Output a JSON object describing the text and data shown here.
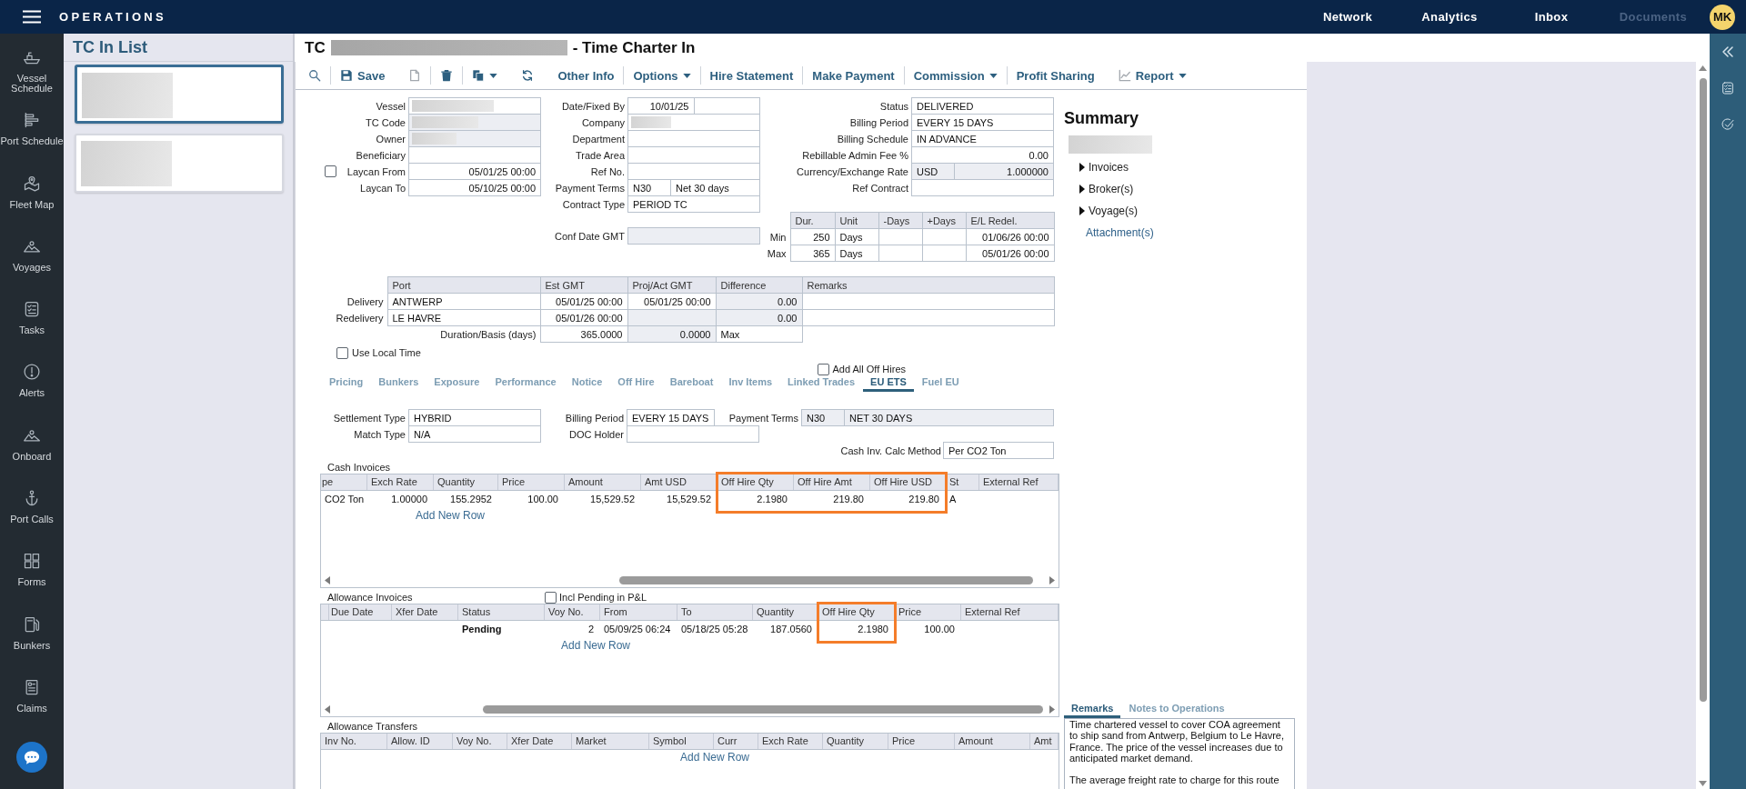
{
  "header": {
    "menu_title": "OPERATIONS",
    "nav": [
      {
        "label": "Network",
        "disabled": false
      },
      {
        "label": "Analytics",
        "disabled": false
      },
      {
        "label": "Inbox",
        "disabled": false
      },
      {
        "label": "Documents",
        "disabled": true
      }
    ],
    "avatar": "MK"
  },
  "sidebar": {
    "items": [
      {
        "label": "Vessel Schedule"
      },
      {
        "label": "Port Schedule"
      },
      {
        "label": "Fleet Map"
      },
      {
        "label": "Voyages"
      },
      {
        "label": "Tasks"
      },
      {
        "label": "Alerts"
      },
      {
        "label": "Onboard"
      },
      {
        "label": "Port Calls"
      },
      {
        "label": "Forms"
      },
      {
        "label": "Bunkers"
      },
      {
        "label": "Claims"
      }
    ]
  },
  "list_panel": {
    "title": "TC In List",
    "cards": [
      {
        "selected": true
      },
      {
        "selected": false
      }
    ]
  },
  "record": {
    "title_prefix": "TC",
    "title_suffix": "- Time Charter In"
  },
  "toolbar": {
    "groups": [
      [
        {
          "kind": "icon"
        }
      ],
      [
        {
          "kind": "icon_text",
          "label": "Save"
        },
        {
          "kind": "icon"
        }
      ],
      [
        {
          "kind": "icon"
        }
      ],
      [
        {
          "kind": "icon_menu"
        },
        {
          "kind": "icon"
        },
        {
          "kind": "text",
          "label": "Other Info"
        }
      ],
      [
        {
          "kind": "menu",
          "label": "Options"
        }
      ],
      [
        {
          "kind": "text",
          "label": "Hire Statement"
        }
      ],
      [
        {
          "kind": "text",
          "label": "Make Payment"
        }
      ],
      [
        {
          "kind": "menu",
          "label": "Commission"
        }
      ],
      [
        {
          "kind": "text",
          "label": "Profit Sharing"
        },
        {
          "kind": "icon_text_menu",
          "label": "Report"
        }
      ]
    ]
  },
  "details": {
    "left": [
      {
        "label": "Vessel",
        "cells": [
          {
            "kind": "redacted",
            "readonly": false
          }
        ]
      },
      {
        "label": "TC Code",
        "cells": [
          {
            "kind": "redacted",
            "readonly": true
          }
        ]
      },
      {
        "label": "Owner",
        "cells": [
          {
            "kind": "redacted",
            "readonly": true
          }
        ]
      },
      {
        "label": "Beneficiary",
        "cells": [
          {
            "readonly": false
          }
        ]
      },
      {
        "label": "Laycan From",
        "checkbox": {
          "checked": false
        },
        "cells": [
          {
            "kind": "number",
            "value": "05/01/25 00:00",
            "readonly": false
          }
        ]
      },
      {
        "label": "Laycan To",
        "cells": [
          {
            "kind": "number",
            "value": "05/10/25 00:00",
            "readonly": false
          }
        ]
      }
    ],
    "middle": [
      {
        "label": "Date/Fixed By",
        "cells": [
          {
            "kind": "number",
            "value": "10/01/25",
            "readonly": false
          },
          {
            "readonly": false
          }
        ]
      },
      {
        "label": "Company",
        "cells": [
          {
            "kind": "redacted",
            "readonly": false
          }
        ]
      },
      {
        "label": "Department",
        "cells": [
          {
            "readonly": false
          }
        ]
      },
      {
        "label": "Trade Area",
        "cells": [
          {
            "readonly": false
          }
        ]
      },
      {
        "label": "Ref No.",
        "cells": [
          {
            "readonly": false
          }
        ]
      },
      {
        "label": "Payment Terms",
        "cells": [
          {
            "kind": "code",
            "value": "N30",
            "readonly": false
          },
          {
            "kind": "text",
            "value": "Net 30 days",
            "readonly": false
          }
        ]
      },
      {
        "label": "Contract Type",
        "cells": [
          {
            "kind": "text",
            "value": "PERIOD TC",
            "readonly": false
          }
        ]
      }
    ],
    "right": [
      {
        "label": "Status",
        "cells": [
          {
            "kind": "text",
            "value": "DELIVERED",
            "readonly": false
          }
        ]
      },
      {
        "label": "Billing Period",
        "cells": [
          {
            "kind": "text",
            "value": "EVERY 15 DAYS",
            "readonly": false
          }
        ]
      },
      {
        "label": "Billing Schedule",
        "cells": [
          {
            "kind": "text",
            "value": "IN ADVANCE",
            "readonly": false
          }
        ]
      },
      {
        "label": "Rebillable Admin Fee %",
        "cells": [
          {
            "kind": "number",
            "value": "0.00",
            "readonly": false
          }
        ]
      },
      {
        "label": "Currency/Exchange Rate",
        "cells": [
          {
            "kind": "code",
            "value": "USD",
            "readonly": true
          },
          {
            "kind": "number",
            "value": "1.000000",
            "readonly": true
          }
        ]
      },
      {
        "label": "Ref Contract",
        "cells": [
          {
            "readonly": false
          }
        ]
      }
    ],
    "conf_date": {
      "label": "Conf Date GMT",
      "cells": [
        {
          "readonly": true
        }
      ]
    },
    "duration": {
      "columns": [
        {
          "label": "Dur.",
          "kind": "number"
        },
        {
          "label": "Unit",
          "kind": "text"
        },
        {
          "label": "-Days"
        },
        {
          "label": "+Days"
        },
        {
          "label": "E/L Redel.",
          "kind": "number"
        }
      ],
      "rows": [
        {
          "label": "Min",
          "cells": [
            "250",
            "Days",
            null,
            null,
            "01/06/26 00:00"
          ]
        },
        {
          "label": "Max",
          "cells": [
            "365",
            "Days",
            null,
            null,
            "05/01/26 00:00"
          ]
        }
      ]
    }
  },
  "ports": {
    "columns": [
      {
        "label": "Port",
        "kind": "text"
      },
      {
        "label": "Est GMT",
        "kind": "number"
      },
      {
        "label": "Proj/Act GMT",
        "kind": "number"
      },
      {
        "label": "Difference",
        "kind": "number"
      },
      {
        "label": "Remarks"
      }
    ],
    "rows": [
      {
        "label": "Delivery",
        "cells": [
          {
            "value": "ANTWERP",
            "readonly": false
          },
          {
            "value": "05/01/25 00:00",
            "readonly": false
          },
          {
            "value": "05/01/25 00:00",
            "readonly": false
          },
          {
            "value": "0.00",
            "readonly": true
          },
          {
            "readonly": false
          }
        ]
      },
      {
        "label": "Redelivery",
        "cells": [
          {
            "value": "LE HAVRE",
            "readonly": false
          },
          {
            "value": "05/01/26 00:00",
            "readonly": false
          },
          {
            "readonly": true
          },
          {
            "value": "0.00",
            "readonly": true
          },
          {
            "readonly": false
          }
        ]
      }
    ],
    "duration_row": {
      "label": "Duration/Basis (days)",
      "cells": [
        {
          "kind": "number",
          "value": "365.0000",
          "readonly": false
        },
        {
          "kind": "number",
          "value": "0.0000",
          "readonly": true
        },
        {
          "kind": "text",
          "value": "Max",
          "readonly": false
        }
      ]
    }
  },
  "use_local_time": {
    "label": "Use Local Time",
    "checked": false
  },
  "add_all_off_hires": {
    "label": "Add All Off Hires",
    "checked": false
  },
  "tabs": [
    {
      "label": "Pricing",
      "selected": false
    },
    {
      "label": "Bunkers",
      "selected": false
    },
    {
      "label": "Exposure",
      "selected": false
    },
    {
      "label": "Performance",
      "selected": false
    },
    {
      "label": "Notice",
      "selected": false
    },
    {
      "label": "Off Hire",
      "selected": false
    },
    {
      "label": "Bareboat",
      "selected": false
    },
    {
      "label": "Inv Items",
      "selected": false
    },
    {
      "label": "Linked Trades",
      "selected": false
    },
    {
      "label": "EU ETS",
      "selected": true
    },
    {
      "label": "Fuel EU",
      "selected": false
    }
  ],
  "eu_ets": {
    "rows": [
      [
        {
          "label": "Settlement Type",
          "cells": [
            {
              "kind": "text",
              "value": "HYBRID",
              "readonly": false
            }
          ]
        },
        {
          "label": "Billing Period",
          "cells": [
            {
              "kind": "text",
              "value": "EVERY 15 DAYS",
              "readonly": false
            }
          ]
        },
        {
          "label": "Payment Terms",
          "cells": [
            {
              "kind": "code",
              "value": "N30",
              "readonly": true
            },
            {
              "kind": "text",
              "value": "NET 30 DAYS",
              "readonly": true
            }
          ]
        }
      ],
      [
        {
          "label": "Match Type",
          "cells": [
            {
              "kind": "text",
              "value": "N/A",
              "readonly": false
            }
          ]
        },
        {
          "label": "DOC Holder",
          "cells": [
            {
              "readonly": false
            }
          ]
        }
      ],
      [
        {
          "label": "Cash Inv. Calc Method",
          "cells": [
            {
              "kind": "text",
              "value": "Per CO2 Ton",
              "readonly": false
            }
          ]
        }
      ]
    ]
  },
  "cash_invoices": {
    "title": "Cash Invoices",
    "columns": [
      {
        "label": "pe",
        "kind": "text",
        "highlighted": false
      },
      {
        "label": "Exch Rate",
        "kind": "number",
        "highlighted": false
      },
      {
        "label": "Quantity",
        "kind": "number",
        "highlighted": false
      },
      {
        "label": "Price",
        "kind": "number",
        "highlighted": false
      },
      {
        "label": "Amount",
        "kind": "number",
        "highlighted": false
      },
      {
        "label": "Amt USD",
        "kind": "number",
        "highlighted": false
      },
      {
        "label": "Off Hire Qty",
        "kind": "number",
        "highlighted": true
      },
      {
        "label": "Off Hire Amt",
        "kind": "number",
        "highlighted": true
      },
      {
        "label": "Off Hire USD",
        "kind": "number",
        "highlighted": true
      },
      {
        "label": "St",
        "kind": "text",
        "highlighted": false
      },
      {
        "label": "External Ref",
        "highlighted": false
      }
    ],
    "rows": [
      [
        "CO2 Ton",
        "1.00000",
        "155.2952",
        "100.00",
        "15,529.52",
        "15,529.52",
        "2.1980",
        "219.80",
        "219.80",
        "A",
        null
      ]
    ],
    "add_row": "Add New Row"
  },
  "allowance_invoices": {
    "title": "Allowance Invoices",
    "checkbox": {
      "label": "Incl Pending in P&L",
      "checked": false
    },
    "columns": [
      {
        "label": "Due Date",
        "highlighted": false
      },
      {
        "label": "Xfer Date",
        "highlighted": false
      },
      {
        "label": "Status",
        "kind": "status",
        "highlighted": false
      },
      {
        "label": "Voy No.",
        "kind": "number",
        "highlighted": false
      },
      {
        "label": "From",
        "kind": "text",
        "highlighted": false
      },
      {
        "label": "To",
        "kind": "text",
        "highlighted": false
      },
      {
        "label": "Quantity",
        "kind": "number",
        "highlighted": false
      },
      {
        "label": "Off Hire Qty",
        "kind": "number",
        "highlighted": true
      },
      {
        "label": "Price",
        "kind": "number",
        "highlighted": false
      },
      {
        "label": "External Ref",
        "highlighted": false
      }
    ],
    "rows": [
      [
        null,
        null,
        "Pending",
        "2",
        "05/09/25 06:24",
        "05/18/25 05:28",
        "187.0560",
        "2.1980",
        "100.00",
        null
      ]
    ],
    "add_row": "Add New Row"
  },
  "allowance_transfers": {
    "title": "Allowance Transfers",
    "columns": [
      {
        "label": "Inv No.",
        "highlighted": false
      },
      {
        "label": "Allow. ID",
        "highlighted": false
      },
      {
        "label": "Voy No.",
        "highlighted": false
      },
      {
        "label": "Xfer Date",
        "highlighted": false
      },
      {
        "label": "Market",
        "highlighted": false
      },
      {
        "label": "Symbol",
        "highlighted": false
      },
      {
        "label": "Curr",
        "highlighted": false
      },
      {
        "label": "Exch Rate",
        "highlighted": false
      },
      {
        "label": "Quantity",
        "highlighted": false
      },
      {
        "label": "Price",
        "highlighted": false
      },
      {
        "label": "Amount",
        "highlighted": false
      },
      {
        "label": "Amt",
        "highlighted": false
      }
    ],
    "add_row": "Add New Row"
  },
  "summary": {
    "title": "Summary",
    "items": [
      {
        "label": "Invoices",
        "expanded": false
      },
      {
        "label": "Broker(s)",
        "expanded": false
      },
      {
        "label": "Voyage(s)",
        "expanded": false
      }
    ],
    "link": "Attachment(s)"
  },
  "remarks": {
    "tabs": [
      {
        "label": "Remarks",
        "selected": true
      },
      {
        "label": "Notes to Operations",
        "selected": false
      }
    ],
    "paragraphs": [
      "Time chartered vessel to cover COA agreement to ship sand from Antwerp, Belgium to Le Havre, France. The price of the vessel increases due to anticipated market demand.",
      "The average freight rate to charge for this route"
    ]
  }
}
